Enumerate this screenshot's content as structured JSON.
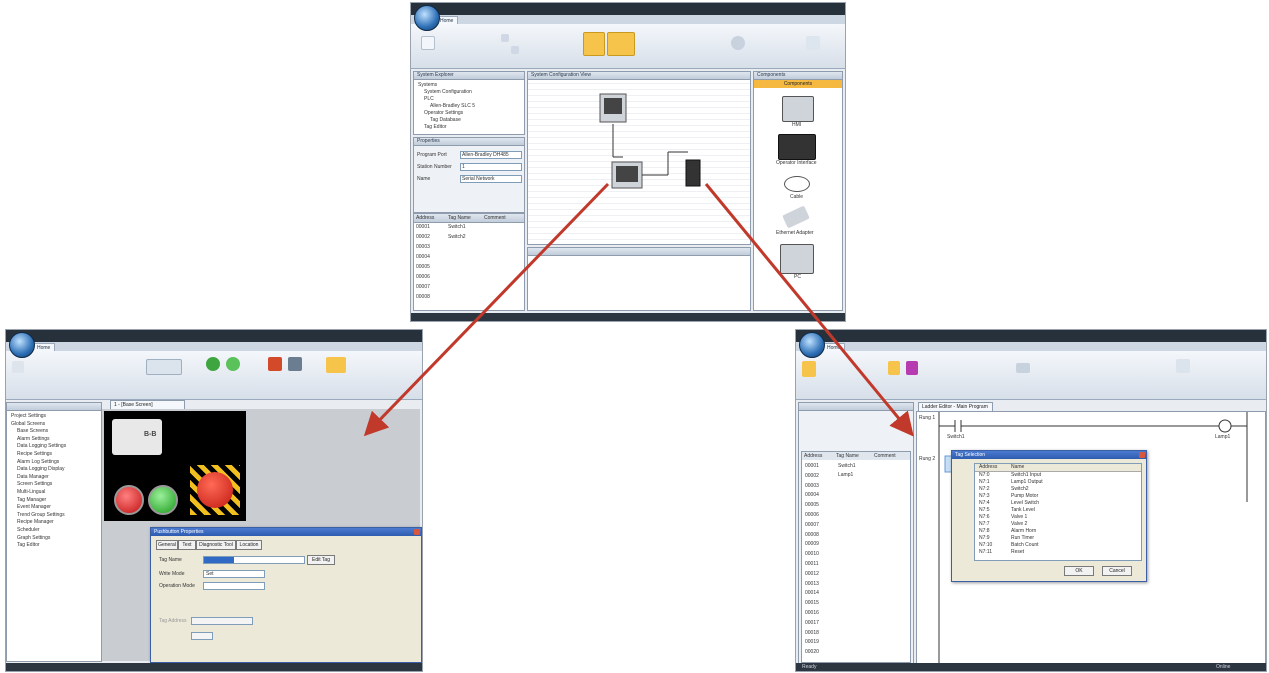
{
  "top": {
    "tab": "Home",
    "panels": {
      "explorer_title": "System Explorer",
      "tree": [
        "Systems",
        "System Configuration",
        "PLC",
        "Allen-Bradley SLC 5",
        "Operator Settings",
        "Tag Database",
        "Tag Editor"
      ],
      "properties_title": "Properties",
      "props": [
        [
          "Program Port",
          "Allen-Bradley DH485"
        ],
        [
          "Station Number",
          "1"
        ],
        [
          "Name",
          "Serial Network"
        ]
      ],
      "tags_headers": [
        "Address",
        "Tag Name",
        "Comment"
      ],
      "tag_rows": [
        [
          "00001",
          "Switch1"
        ],
        [
          "00002",
          "Switch2"
        ],
        [
          "00003",
          ""
        ],
        [
          "00004",
          ""
        ],
        [
          "00005",
          ""
        ],
        [
          "00006",
          ""
        ],
        [
          "00007",
          ""
        ],
        [
          "00008",
          ""
        ]
      ],
      "diagram_title": "System Configuration View",
      "components_title": "Components",
      "components_header": "Components",
      "components": [
        "HMI",
        "Operator Interface",
        "Cable",
        "Ethernet Adapter",
        "PC"
      ]
    }
  },
  "left": {
    "tab": "Home",
    "doc_tab": "1 - [Base Screen]",
    "tree": [
      "Project Settings",
      "Global Screens",
      "Base Screens",
      "Alarm Settings",
      "Data Logging Settings",
      "Recipe Settings",
      "Alarm Log Settings",
      "Data Logging Display",
      "Data Manager",
      "Screen Settings",
      "Multi-Lingual",
      "Tag Manager",
      "Event Manager",
      "Trend Group Settings",
      "Recipe Manager",
      "Scheduler",
      "Graph Settings",
      "Tag Editor"
    ],
    "logo_text": "B-B",
    "dialog": {
      "title": "Pushbutton Properties",
      "tabs": [
        "General",
        "Text",
        "Diagnostic Tool",
        "Location"
      ],
      "rows": [
        "Tag Name",
        "Write Mode",
        "Operation Mode",
        "Tag Address"
      ],
      "edit_button": "Edit Tag",
      "mode_value": "Set"
    }
  },
  "right": {
    "tab": "Home",
    "doc_tab": "Ladder Editor - Main Program",
    "rung_labels": [
      "Rung 1",
      "Rung 2"
    ],
    "contact_label": "Switch1",
    "coil_label": "Lamp1",
    "side_header": [
      "Address",
      "Tag Name",
      "Comment"
    ],
    "side_rows": [
      "00001",
      "00002",
      "00003",
      "00004",
      "00005",
      "00006",
      "00007",
      "00008",
      "00009",
      "00010",
      "00011",
      "00012",
      "00013",
      "00014",
      "00015",
      "00016",
      "00017",
      "00018",
      "00019",
      "00020"
    ],
    "side_names": [
      "Switch1",
      "Lamp1"
    ],
    "dialog": {
      "title": "Tag Selection",
      "headers": [
        "Address",
        "Name"
      ],
      "rows": [
        [
          "N7:0",
          "Switch1 Input"
        ],
        [
          "N7:1",
          "Lamp1 Output"
        ],
        [
          "N7:2",
          "Switch2"
        ],
        [
          "N7:3",
          "Pump Motor"
        ],
        [
          "N7:4",
          "Level Switch"
        ],
        [
          "N7:5",
          "Tank Level"
        ],
        [
          "N7:6",
          "Valve 1"
        ],
        [
          "N7:7",
          "Valve 2"
        ],
        [
          "N7:8",
          "Alarm Horn"
        ],
        [
          "N7:9",
          "Run Timer"
        ],
        [
          "N7:10",
          "Batch Count"
        ],
        [
          "N7:11",
          "Reset"
        ]
      ],
      "ok": "OK",
      "cancel": "Cancel"
    },
    "status": [
      "Ready",
      "Online"
    ]
  },
  "colors": {
    "arrow": "#c0392b"
  }
}
